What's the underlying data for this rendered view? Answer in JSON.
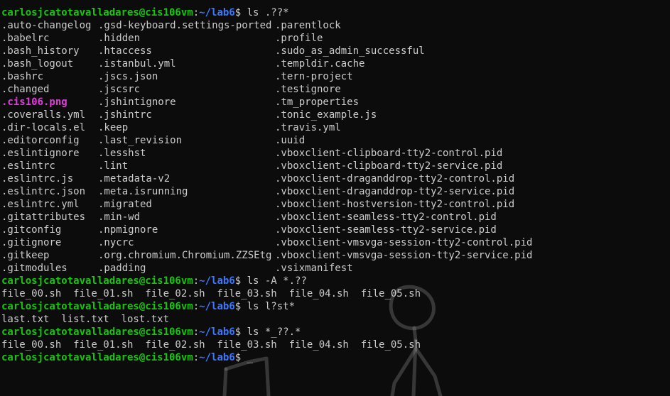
{
  "terminal": {
    "prompt": {
      "user_host": "carlosjcatotavalladares@cis106vm",
      "sep": ":",
      "cwd": "~/lab6",
      "symbol": "$ "
    },
    "commands": {
      "cmd1": "ls .??*",
      "cmd2": "ls -A *.??",
      "cmd3": "ls l?st*",
      "cmd4": "ls *_??.*"
    },
    "listing1": {
      "col1": [
        ".auto-changelog",
        ".babelrc",
        ".bash_history",
        ".bash_logout",
        ".bashrc",
        ".changed",
        ".cis106.png",
        ".coveralls.yml",
        ".dir-locals.el",
        ".editorconfig",
        ".eslintignore",
        ".eslintrc",
        ".eslintrc.js",
        ".eslintrc.json",
        ".eslintrc.yml",
        ".gitattributes",
        ".gitconfig",
        ".gitignore",
        ".gitkeep",
        ".gitmodules"
      ],
      "col2": [
        ".gsd-keyboard.settings-ported",
        ".hidden",
        ".htaccess",
        ".istanbul.yml",
        ".jscs.json",
        ".jscsrc",
        ".jshintignore",
        ".jshintrc",
        ".keep",
        ".last_revision",
        ".lesshst",
        ".lint",
        ".metadata-v2",
        ".meta.isrunning",
        ".migrated",
        ".min-wd",
        ".npmignore",
        ".nycrc",
        ".org.chromium.Chromium.ZZSEtg",
        ".padding"
      ],
      "col3": [
        ".parentlock",
        ".profile",
        ".sudo_as_admin_successful",
        ".templdir.cache",
        ".tern-project",
        ".testignore",
        ".tm_properties",
        ".tonic_example.js",
        ".travis.yml",
        ".uuid",
        ".vboxclient-clipboard-tty2-control.pid",
        ".vboxclient-clipboard-tty2-service.pid",
        ".vboxclient-draganddrop-tty2-control.pid",
        ".vboxclient-draganddrop-tty2-service.pid",
        ".vboxclient-hostversion-tty2-control.pid",
        ".vboxclient-seamless-tty2-control.pid",
        ".vboxclient-seamless-tty2-service.pid",
        ".vboxclient-vmsvga-session-tty2-control.pid",
        ".vboxclient-vmsvga-session-tty2-service.pid",
        ".vsixmanifest"
      ]
    },
    "output2": "file_00.sh  file_01.sh  file_02.sh  file_03.sh  file_04.sh  file_05.sh",
    "output3": "last.txt  list.txt  lost.txt",
    "output4": "file_00.sh  file_01.sh  file_02.sh  file_03.sh  file_04.sh  file_05.sh",
    "cursor": "_",
    "highlight_color": "#e23cdd",
    "user_color": "#16c60c",
    "path_color": "#3b78ff",
    "background_color": "#0c0c0c"
  }
}
